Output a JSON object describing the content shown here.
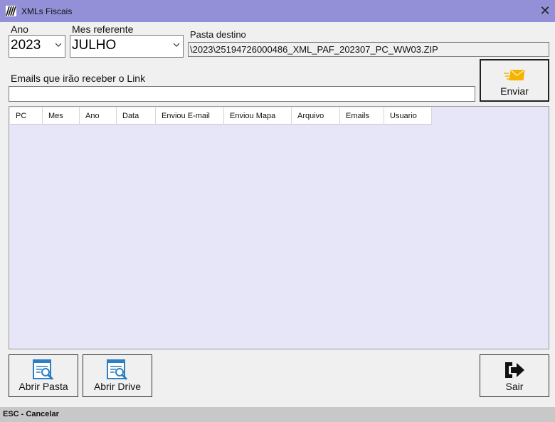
{
  "window": {
    "title": "XMLs Fiscais",
    "close_glyph": "✕"
  },
  "ano": {
    "label": "Ano",
    "value": "2023"
  },
  "mes": {
    "label": "Mes referente",
    "value": "JULHO"
  },
  "pasta": {
    "label": "Pasta destino",
    "value": "\\2023\\25194726000486_XML_PAF_202307_PC_WW03.ZIP"
  },
  "emails": {
    "label": "Emails que irão receber o Link",
    "value": ""
  },
  "buttons": {
    "enviar": "Enviar",
    "abrir_pasta": "Abrir Pasta",
    "abrir_drive": "Abrir Drive",
    "sair": "Sair"
  },
  "grid": {
    "columns": [
      "PC",
      "Mes",
      "Ano",
      "Data",
      "Enviou E-mail",
      "Enviou Mapa",
      "Arquivo",
      "Emails",
      "Usuario"
    ],
    "rows": []
  },
  "status": {
    "text": "ESC - Cancelar"
  },
  "icons": {
    "app": "zebra-icon",
    "enviar": "envelope-fast-icon",
    "abrir_pasta": "document-search-icon",
    "abrir_drive": "document-search-icon",
    "sair": "exit-arrow-icon"
  },
  "colors": {
    "titlebar": "#9490d8",
    "grid_bg": "#e6e6f8",
    "accent_icon": "#2b7fc4",
    "envelope": "#f5b400"
  }
}
